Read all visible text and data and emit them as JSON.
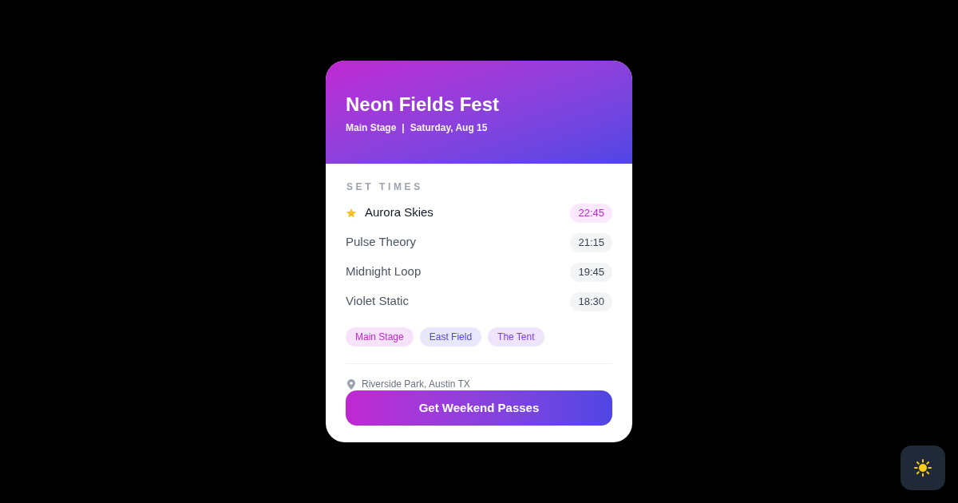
{
  "event": {
    "title": "Neon Fields Fest",
    "venue": "Main Stage",
    "separator": "|",
    "date": "Saturday, Aug 15"
  },
  "set_times": {
    "heading": "SET TIMES",
    "acts": [
      {
        "name": "Aurora Skies",
        "time": "22:45",
        "starred": true
      },
      {
        "name": "Pulse Theory",
        "time": "21:15",
        "starred": false
      },
      {
        "name": "Midnight Loop",
        "time": "19:45",
        "starred": false
      },
      {
        "name": "Violet Static",
        "time": "18:30",
        "starred": false
      }
    ]
  },
  "stages": [
    {
      "label": "Main Stage",
      "color": "#c026d3"
    },
    {
      "label": "East Field",
      "color": "#4f46e5"
    },
    {
      "label": "The Tent",
      "color": "#7c3aed"
    }
  ],
  "location": "Riverside Park, Austin TX",
  "cta": {
    "label": "Get Weekend Passes"
  }
}
